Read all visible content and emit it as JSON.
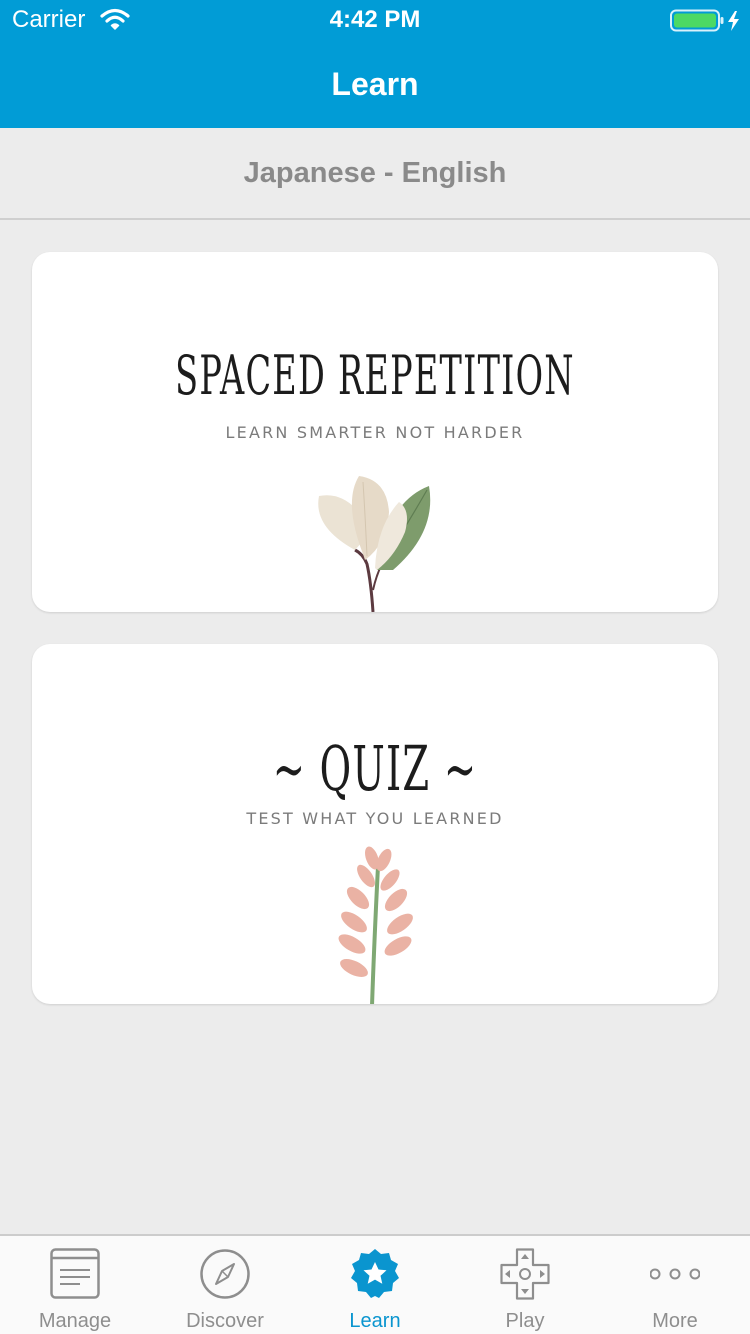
{
  "status_bar": {
    "carrier": "Carrier",
    "time": "4:42 PM"
  },
  "nav": {
    "title": "Learn"
  },
  "language_pair": "Japanese - English",
  "cards": [
    {
      "title": "SPACED REPETITION",
      "subtitle": "LEARN SMARTER NOT HARDER",
      "illustration": "leaves-illustration"
    },
    {
      "title": "~ QUIZ ~",
      "subtitle": "TEST WHAT YOU LEARNED",
      "illustration": "flower-illustration"
    }
  ],
  "tabs": [
    {
      "label": "Manage",
      "icon": "document-icon",
      "active": false
    },
    {
      "label": "Discover",
      "icon": "compass-icon",
      "active": false
    },
    {
      "label": "Learn",
      "icon": "star-badge-icon",
      "active": true
    },
    {
      "label": "Play",
      "icon": "gamepad-icon",
      "active": false
    },
    {
      "label": "More",
      "icon": "more-dots-icon",
      "active": false
    }
  ],
  "colors": {
    "header": "#019cd6",
    "background": "#ececec",
    "active_tab": "#0a95cf",
    "inactive_tab": "#8e8e8e",
    "battery": "#4cd964"
  }
}
